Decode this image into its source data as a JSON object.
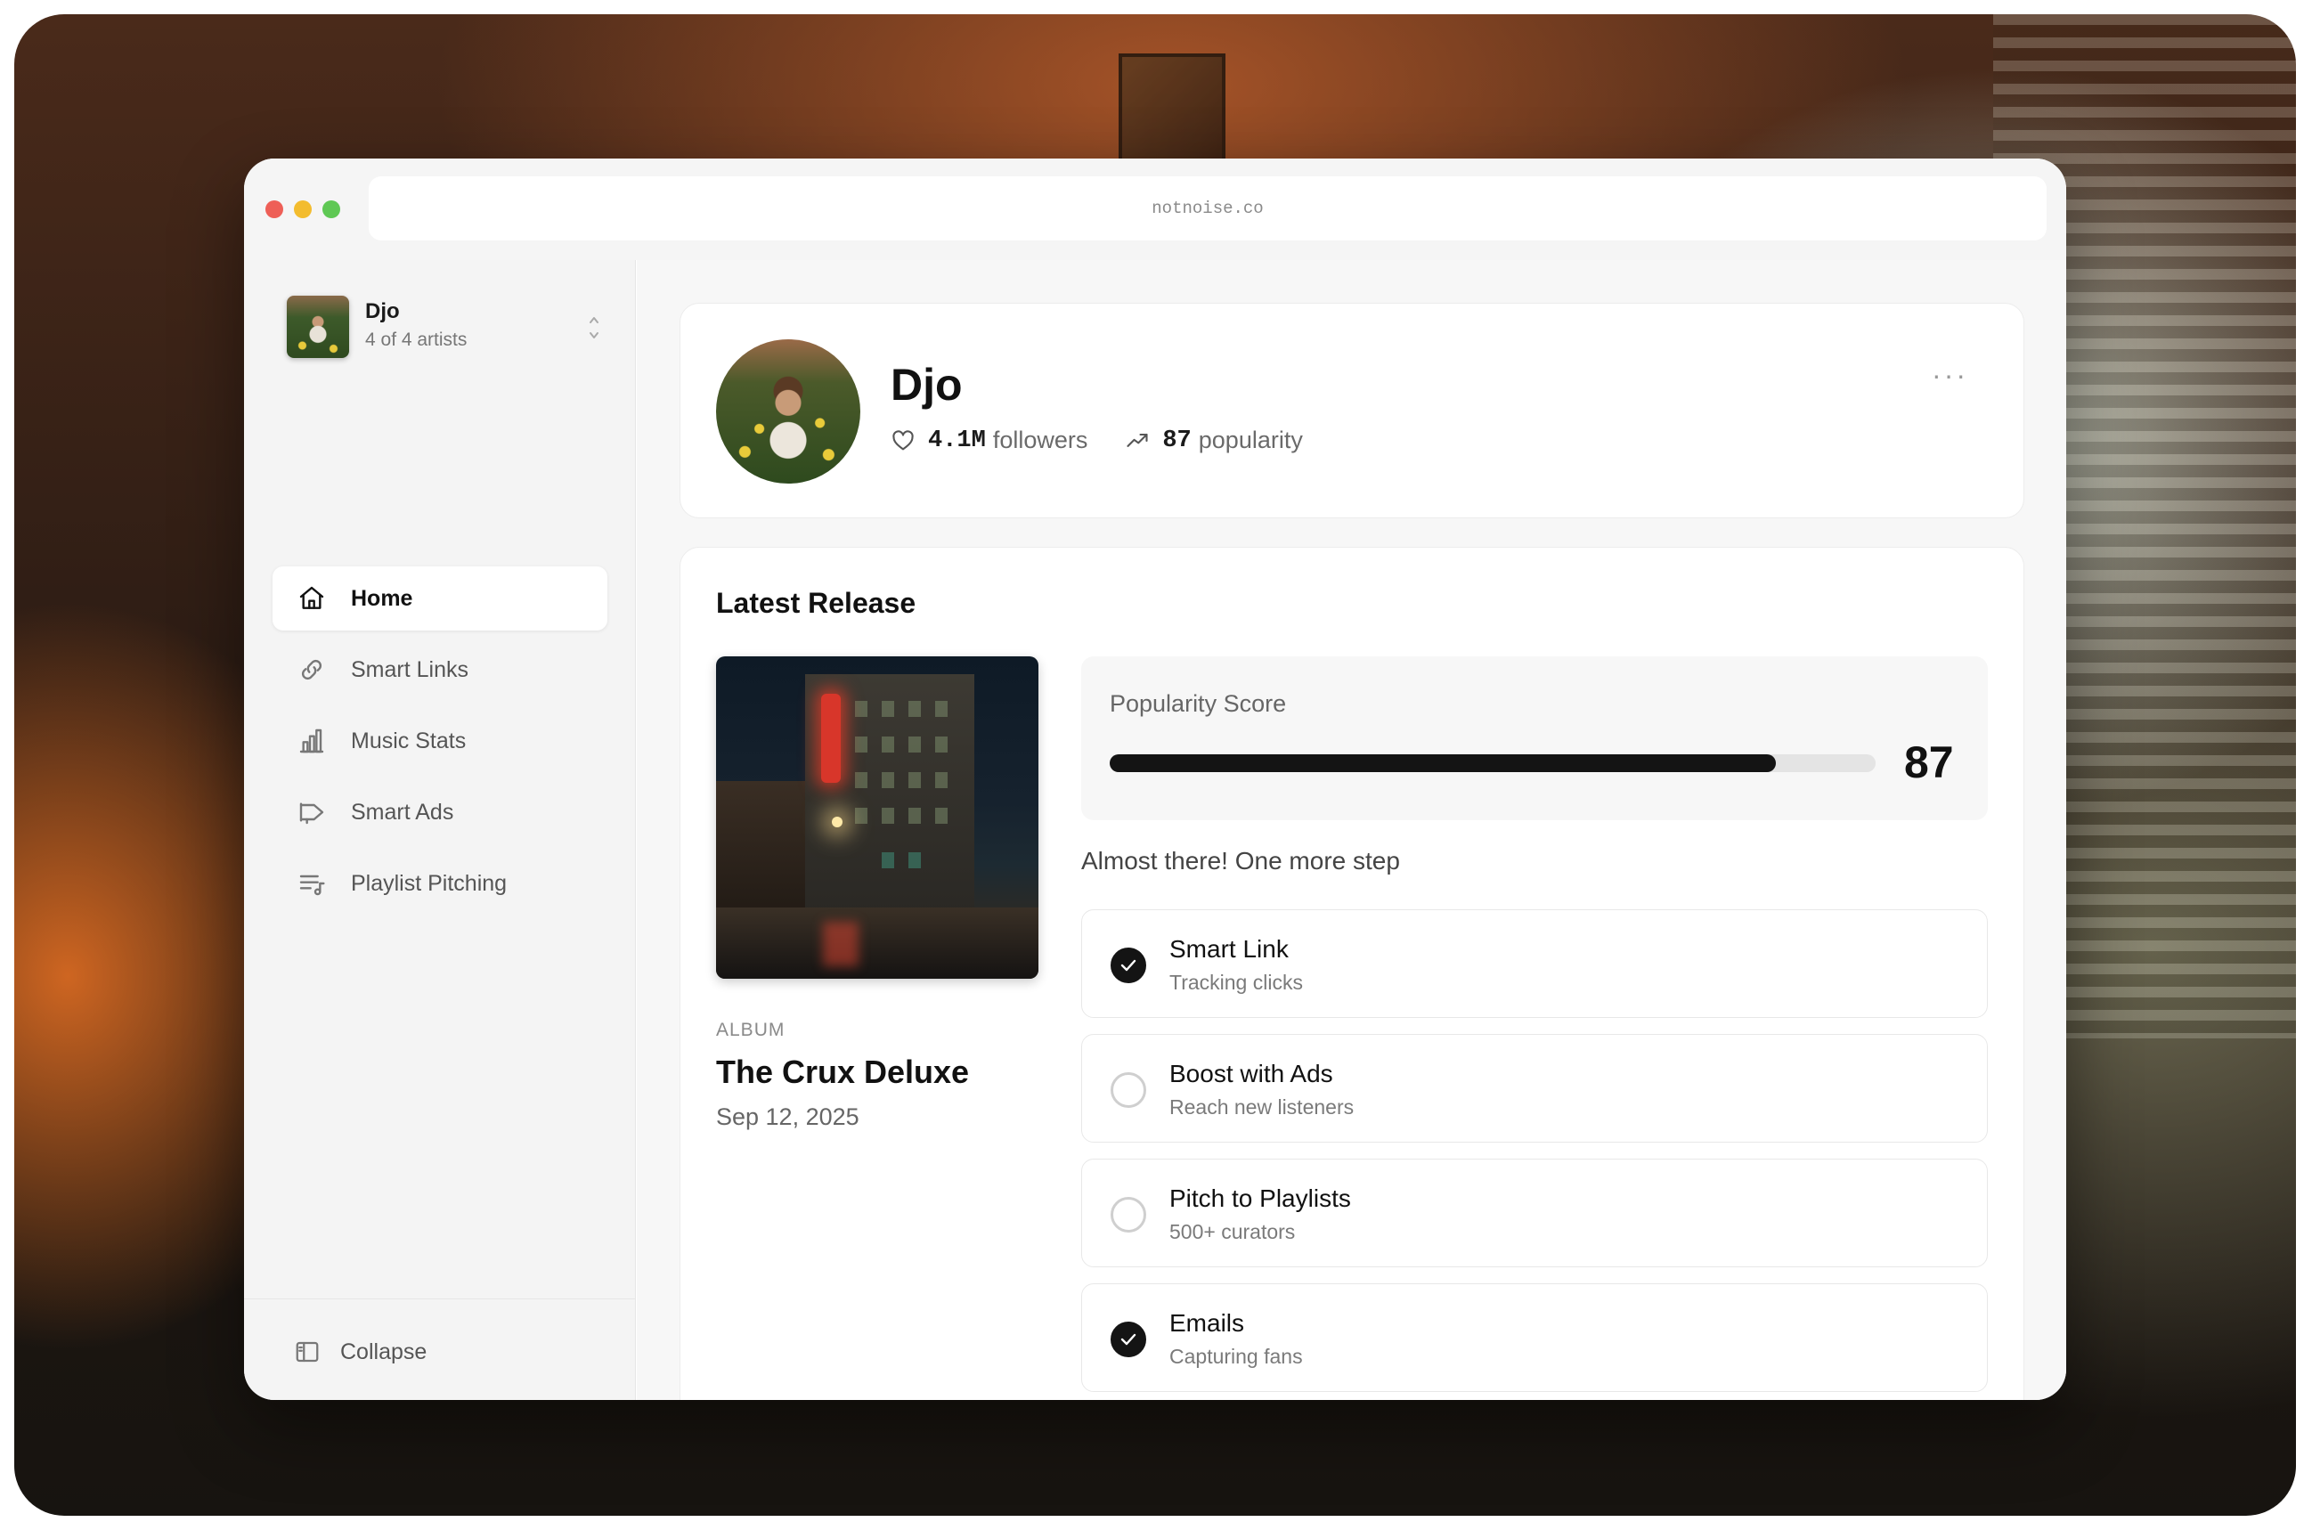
{
  "browser": {
    "url": "notnoise.co"
  },
  "sidebar": {
    "artist": {
      "name": "Djo",
      "count": "4 of 4 artists"
    },
    "items": [
      {
        "label": "Home",
        "icon": "home-icon",
        "active": true
      },
      {
        "label": "Smart Links",
        "icon": "link-icon",
        "active": false
      },
      {
        "label": "Music Stats",
        "icon": "bar-chart-icon",
        "active": false
      },
      {
        "label": "Smart Ads",
        "icon": "megaphone-icon",
        "active": false
      },
      {
        "label": "Playlist Pitching",
        "icon": "playlist-icon",
        "active": false
      }
    ],
    "collapse_label": "Collapse"
  },
  "profile": {
    "name": "Djo",
    "followers_value": "4.1M",
    "followers_label": "followers",
    "popularity_value": "87",
    "popularity_label": "popularity",
    "more_label": "···"
  },
  "release": {
    "section_title": "Latest Release",
    "type": "ALBUM",
    "name": "The Crux Deluxe",
    "date": "Sep 12, 2025",
    "score_label": "Popularity Score",
    "score_value": "87",
    "score_fraction": 0.87,
    "hint": "Almost there! One more step",
    "steps": [
      {
        "title": "Smart Link",
        "subtitle": "Tracking clicks",
        "done": true
      },
      {
        "title": "Boost with Ads",
        "subtitle": "Reach new listeners",
        "done": false
      },
      {
        "title": "Pitch to Playlists",
        "subtitle": "500+ curators",
        "done": false
      },
      {
        "title": "Emails",
        "subtitle": "Capturing fans",
        "done": true
      }
    ]
  },
  "colors": {
    "accent": "#141414",
    "sidebar_bg": "#f4f4f4",
    "main_bg": "#f7f7f7"
  }
}
